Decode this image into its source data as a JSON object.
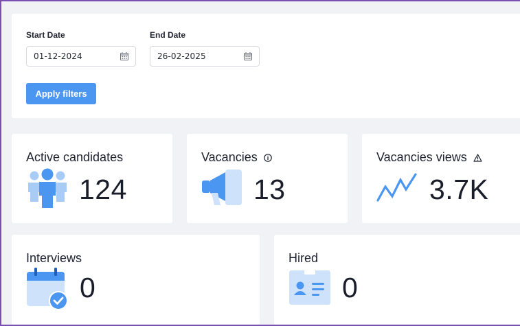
{
  "filters": {
    "start_label": "Start Date",
    "start_value": "01-12-2024",
    "end_label": "End Date",
    "end_value": "26-02-2025",
    "apply_label": "Apply filters"
  },
  "stats": {
    "active_candidates": {
      "title": "Active candidates",
      "value": "124",
      "icon": "people-icon"
    },
    "vacancies": {
      "title": "Vacancies",
      "value": "13",
      "icon": "megaphone-icon",
      "badge": "info-icon"
    },
    "vacancies_views": {
      "title": "Vacancies views",
      "value": "3.7K",
      "icon": "trend-line-icon",
      "badge": "warning-icon"
    },
    "interviews": {
      "title": "Interviews",
      "value": "0",
      "icon": "calendar-check-icon"
    },
    "hired": {
      "title": "Hired",
      "value": "0",
      "icon": "id-card-icon"
    }
  },
  "colors": {
    "accent": "#4b96f1",
    "icon_blue": "#5aa2f2",
    "icon_light": "#cfe2fb",
    "background": "#f1f2f5",
    "frame": "#7a4fb3"
  }
}
